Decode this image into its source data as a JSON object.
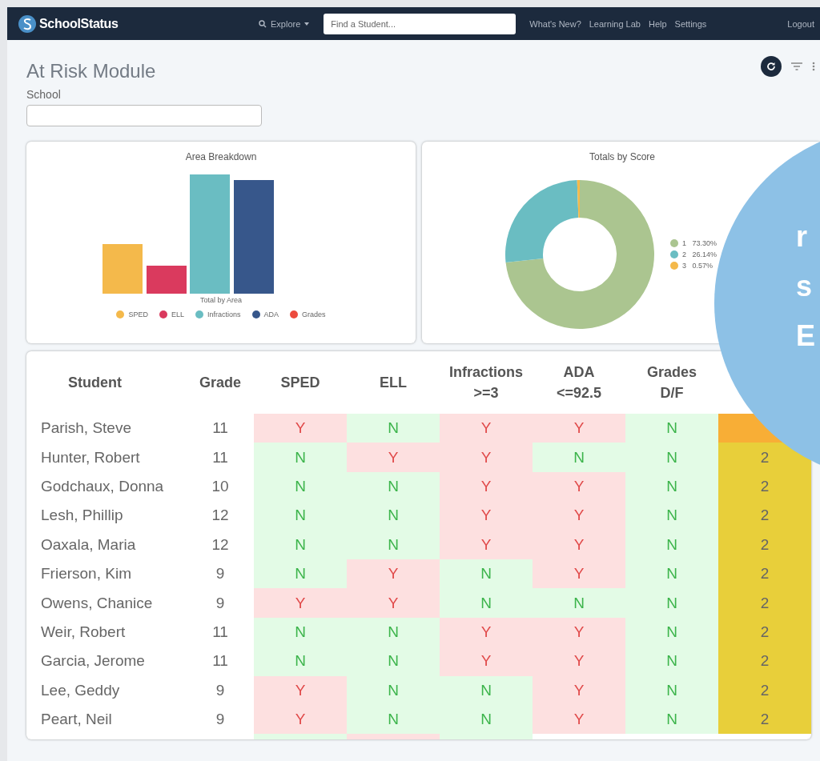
{
  "navbar": {
    "brand": "SchoolStatus",
    "explore": "Explore",
    "search_placeholder": "Find a Student...",
    "links": [
      "What's New?",
      "Learning Lab",
      "Help",
      "Settings"
    ],
    "logout": "Logout"
  },
  "page": {
    "title": "At Risk Module",
    "school_label": "School"
  },
  "area_chart": {
    "title": "Area Breakdown",
    "axis_label": "Total by Area",
    "legend": [
      {
        "label": "SPED",
        "color": "#f4b94b"
      },
      {
        "label": "ELL",
        "color": "#da3a5e"
      },
      {
        "label": "Infractions",
        "color": "#6abdc2"
      },
      {
        "label": "ADA",
        "color": "#37578b"
      },
      {
        "label": "Grades",
        "color": "#ec4b3e"
      }
    ]
  },
  "score_chart": {
    "chart_data": {
      "type": "donut",
      "title": "Totals by Score",
      "categories": [
        "1",
        "2",
        "3"
      ],
      "values": [
        73.3,
        26.14,
        0.57
      ],
      "value_labels": [
        "73.30%",
        "26.14%",
        "0.57%"
      ],
      "colors": [
        "#abc590",
        "#6abdc2",
        "#f4b94b"
      ]
    }
  },
  "table": {
    "columns": [
      "Student",
      "Grade",
      "SPED",
      "ELL",
      "Infractions >=3",
      "ADA <=92.5",
      "Grades D/F"
    ],
    "rows": [
      {
        "kind": "full",
        "name": "Parish, Steve",
        "grade": "11",
        "flags": [
          {
            "text": "Y",
            "flagged": true
          },
          {
            "text": "N",
            "flagged": false
          },
          {
            "text": "Y",
            "flagged": true
          },
          {
            "text": "Y",
            "flagged": true
          },
          {
            "text": "N",
            "flagged": false
          }
        ],
        "color": "#f8ae36"
      },
      {
        "kind": "full",
        "name": "Hunter, Robert",
        "grade": "11",
        "flags": [
          {
            "text": "N",
            "flagged": false
          },
          {
            "text": "Y",
            "flagged": true
          },
          {
            "text": "Y",
            "flagged": true
          },
          {
            "text": "N",
            "flagged": false
          },
          {
            "text": "N",
            "flagged": false
          }
        ],
        "score": "2",
        "color": "#e8cf3a"
      },
      {
        "kind": "full",
        "name": "Godchaux, Donna",
        "grade": "10",
        "flags": [
          {
            "text": "N",
            "flagged": false
          },
          {
            "text": "N",
            "flagged": false
          },
          {
            "text": "Y",
            "flagged": true
          },
          {
            "text": "Y",
            "flagged": true
          },
          {
            "text": "N",
            "flagged": false
          }
        ],
        "score": "2",
        "color": "#e8cf3a"
      },
      {
        "kind": "full",
        "name": "Lesh, Phillip",
        "grade": "12",
        "flags": [
          {
            "text": "N",
            "flagged": false
          },
          {
            "text": "N",
            "flagged": false
          },
          {
            "text": "Y",
            "flagged": true
          },
          {
            "text": "Y",
            "flagged": true
          },
          {
            "text": "N",
            "flagged": false
          }
        ],
        "score": "2",
        "color": "#e8cf3a"
      },
      {
        "kind": "full",
        "name": "Oaxala, Maria",
        "grade": "12",
        "flags": [
          {
            "text": "N",
            "flagged": false
          },
          {
            "text": "N",
            "flagged": false
          },
          {
            "text": "Y",
            "flagged": true
          },
          {
            "text": "Y",
            "flagged": true
          },
          {
            "text": "N",
            "flagged": false
          }
        ],
        "score": "2",
        "color": "#e8cf3a"
      },
      {
        "kind": "full",
        "name": "Frierson, Kim",
        "grade": "9",
        "flags": [
          {
            "text": "N",
            "flagged": false
          },
          {
            "text": "Y",
            "flagged": true
          },
          {
            "text": "N",
            "flagged": false
          },
          {
            "text": "Y",
            "flagged": true
          },
          {
            "text": "N",
            "flagged": false
          }
        ],
        "score": "2",
        "color": "#e8cf3a"
      },
      {
        "kind": "full",
        "name": "Owens, Chanice",
        "grade": "9",
        "flags": [
          {
            "text": "Y",
            "flagged": true
          },
          {
            "text": "Y",
            "flagged": true
          },
          {
            "text": "N",
            "flagged": false
          },
          {
            "text": "N",
            "flagged": false
          },
          {
            "text": "N",
            "flagged": false
          }
        ],
        "score": "2",
        "color": "#e8cf3a"
      },
      {
        "kind": "full",
        "name": "Weir, Robert",
        "grade": "11",
        "flags": [
          {
            "text": "N",
            "flagged": false
          },
          {
            "text": "N",
            "flagged": false
          },
          {
            "text": "Y",
            "flagged": true
          },
          {
            "text": "Y",
            "flagged": true
          },
          {
            "text": "N",
            "flagged": false
          }
        ],
        "score": "2",
        "color": "#e8cf3a"
      },
      {
        "kind": "full",
        "name": "Garcia, Jerome",
        "grade": "11",
        "flags": [
          {
            "text": "N",
            "flagged": false
          },
          {
            "text": "N",
            "flagged": false
          },
          {
            "text": "Y",
            "flagged": true
          },
          {
            "text": "Y",
            "flagged": true
          },
          {
            "text": "N",
            "flagged": false
          }
        ],
        "score": "2",
        "color": "#e8cf3a"
      },
      {
        "kind": "full",
        "name": "Lee, Geddy",
        "grade": "9",
        "flags": [
          {
            "text": "Y",
            "flagged": true
          },
          {
            "text": "N",
            "flagged": false
          },
          {
            "text": "N",
            "flagged": false
          },
          {
            "text": "Y",
            "flagged": true
          },
          {
            "text": "N",
            "flagged": false
          }
        ],
        "score": "2",
        "color": "#e8cf3a"
      },
      {
        "kind": "full",
        "name": "Peart, Neil",
        "grade": "9",
        "flags": [
          {
            "text": "Y",
            "flagged": true
          },
          {
            "text": "N",
            "flagged": false
          },
          {
            "text": "N",
            "flagged": false
          },
          {
            "text": "Y",
            "flagged": true
          },
          {
            "text": "N",
            "flagged": false
          }
        ],
        "score": "2",
        "color": "#e8cf3a"
      },
      {
        "kind": "partial",
        "flags": [
          {
            "flagged": false
          },
          {
            "flagged": true
          },
          {
            "flagged": false
          }
        ]
      }
    ]
  },
  "promo": {
    "lines": [
      "r",
      "s",
      "E"
    ]
  }
}
